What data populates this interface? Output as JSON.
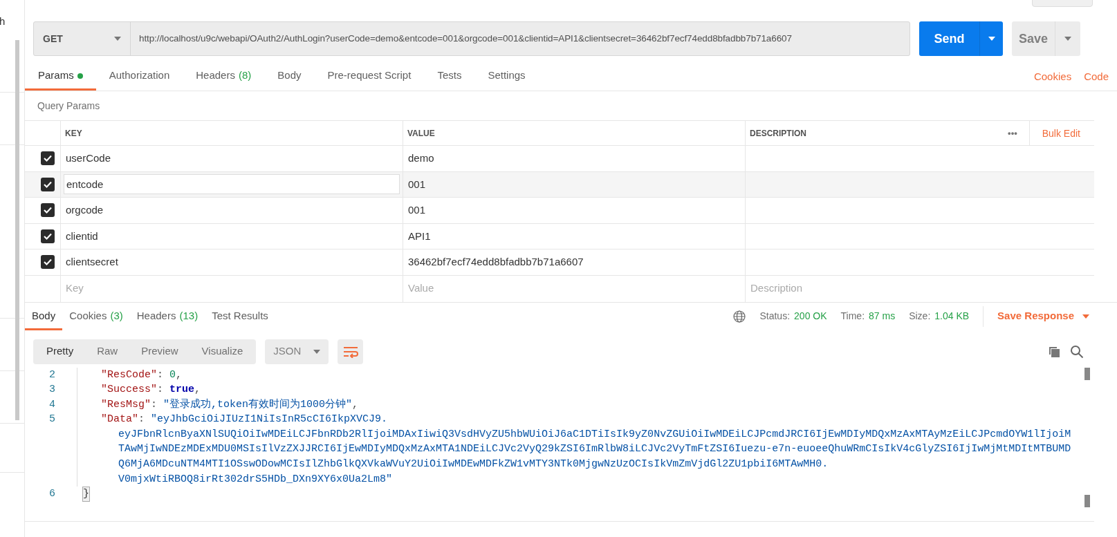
{
  "sidebar": {
    "text": "h"
  },
  "request": {
    "method": "GET",
    "url": "http://localhost/u9c/webapi/OAuth2/AuthLogin?userCode=demo&entcode=001&orgcode=001&clientid=API1&clientsecret=36462bf7ecf74edd8bfadbb7b71a6607",
    "send": "Send",
    "save": "Save"
  },
  "request_tabs": [
    {
      "label": "Params",
      "dot": true,
      "selected": true
    },
    {
      "label": "Authorization",
      "dot": false,
      "selected": false
    },
    {
      "label": "Headers",
      "count": "(8)",
      "dot": false,
      "selected": false
    },
    {
      "label": "Body",
      "dot": false,
      "selected": false
    },
    {
      "label": "Pre-request Script",
      "dot": false,
      "selected": false
    },
    {
      "label": "Tests",
      "dot": false,
      "selected": false
    },
    {
      "label": "Settings",
      "dot": false,
      "selected": false
    }
  ],
  "request_links": [
    "Cookies",
    "Code"
  ],
  "params": {
    "title": "Query Params",
    "columns": [
      "KEY",
      "VALUE",
      "DESCRIPTION"
    ],
    "bulk_edit": "Bulk Edit",
    "more": "•••",
    "rows": [
      {
        "checked": true,
        "active": false,
        "key": "userCode",
        "value": "demo"
      },
      {
        "checked": true,
        "active": true,
        "key": "entcode",
        "value": "001"
      },
      {
        "checked": true,
        "active": false,
        "key": "orgcode",
        "value": "001"
      },
      {
        "checked": true,
        "active": false,
        "key": "clientid",
        "value": "API1"
      },
      {
        "checked": true,
        "active": false,
        "key": "clientsecret",
        "value": "36462bf7ecf74edd8bfadbb7b71a6607"
      }
    ],
    "new_row": {
      "key": {
        "placeholder": "Key"
      },
      "value": {
        "placeholder": "Value"
      },
      "description": {
        "placeholder": "Description"
      }
    }
  },
  "response_tabs": [
    {
      "label": "Body",
      "selected": true
    },
    {
      "label": "Cookies",
      "count": "(3)",
      "selected": false
    },
    {
      "label": "Headers",
      "count": "(13)",
      "selected": false
    },
    {
      "label": "Test Results",
      "selected": false
    }
  ],
  "response_meta": [
    {
      "label": "Status:",
      "value": "200 OK"
    },
    {
      "label": "Time:",
      "value": "87 ms"
    },
    {
      "label": "Size:",
      "value": "1.04 KB"
    }
  ],
  "save_response": "Save Response",
  "view_modes": [
    {
      "label": "Pretty",
      "selected": true
    },
    {
      "label": "Raw",
      "selected": false
    },
    {
      "label": "Preview",
      "selected": false
    },
    {
      "label": "Visualize",
      "selected": false
    }
  ],
  "format": "JSON",
  "code": [
    {
      "number": "2",
      "key": "\"ResCode\"",
      "sep": ":",
      "kind": "number",
      "value": [
        "0"
      ],
      "end": ","
    },
    {
      "number": "3",
      "key": "\"Success\"",
      "sep": ":",
      "kind": "boolean",
      "value": [
        "true"
      ],
      "end": ","
    },
    {
      "number": "4",
      "key": "\"ResMsg\"",
      "sep": ":",
      "kind": "string",
      "value": [
        "\"登录成功,token有效时间为1000分钟\""
      ],
      "end": ","
    },
    {
      "number": "5",
      "key": "\"Data\"",
      "sep": ":",
      "kind": "string",
      "value": [
        "\"eyJhbGciOiJIUzI1NiIsInR5cCI6IkpXVCJ9.",
        "eyJFbnRlcnByaXNlSUQiOiIwMDEiLCJFbnRDb2RlIjoiMDAxIiwiQ3VsdHVyZU5hbWUiOiJ6aC1DTiIsIk9yZ0NvZGUiOiIwMDEiLCJPcmdJRCI6IjEwMDIyMDQxMzAxMTAyMzEiLCJPcmdOYW1lIjoiM",
        "TAwMjIwNDEzMDExMDU0MSIsIlVzZXJJRCI6IjEwMDIyMDQxMzAxMTA1NDEiLCJVc2VyQ29kZSI6ImRlbW8iLCJVc2VyTmFtZSI6Iuezu-e7n-euoeeQhuWRmCIsIkV4cGlyZSI6IjIwMjMtMDItMTBUMD",
        "Q6MjA6MDcuNTM4MTI1OSswODowMCIsIlZhbGlkQXVkaWVuY2UiOiIwMDEwMDFkZW1vMTY3NTk0MjgwNzUzOCIsIkVmZmVjdGl2ZU1pbiI6MTAwMH0.",
        "V0mjxWtiRBOQ8irRt302drS5HDb_DXn9XY6x0Ua2Lm8\""
      ]
    },
    {
      "number": "6",
      "key": "}",
      "kind": "close"
    }
  ]
}
